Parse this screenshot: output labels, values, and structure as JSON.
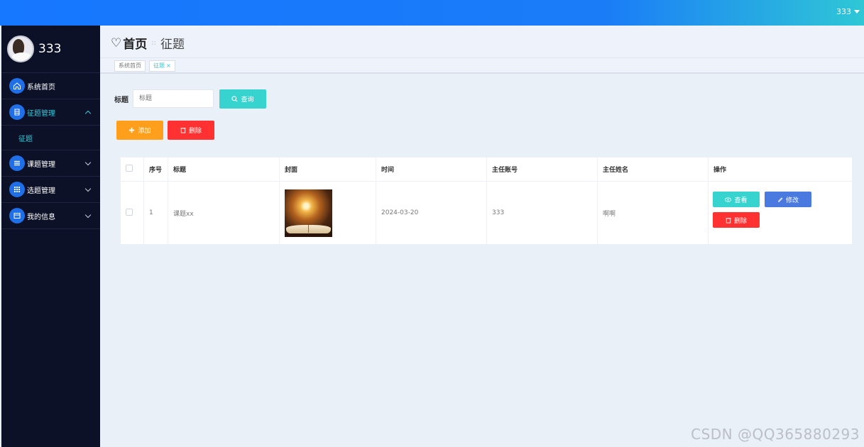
{
  "topbar": {
    "user": "333"
  },
  "sidebar": {
    "username": "333",
    "items": [
      {
        "label": "系统首页",
        "icon": "home-icon"
      },
      {
        "label": "征题管理",
        "icon": "book-icon"
      },
      {
        "label": "课题管理",
        "icon": "list-icon"
      },
      {
        "label": "选题管理",
        "icon": "grid-icon"
      },
      {
        "label": "我的信息",
        "icon": "card-icon"
      }
    ],
    "submenu": [
      {
        "label": "征题"
      }
    ]
  },
  "header": {
    "home": "首页",
    "separator": "::",
    "current": "征题"
  },
  "tags": [
    {
      "label": "系统首页"
    },
    {
      "label": "征题"
    }
  ],
  "search": {
    "label": "标题",
    "placeholder": "标题",
    "button": "查询"
  },
  "actions": {
    "add": "添加",
    "delete": "删除"
  },
  "table": {
    "headers": [
      "序号",
      "标题",
      "封面",
      "时间",
      "主任账号",
      "主任姓名",
      "操作"
    ],
    "rows": [
      {
        "index": "1",
        "title": "课题xx",
        "time": "2024-03-20",
        "account": "333",
        "name": "啊啊"
      }
    ],
    "ops": {
      "view": "查看",
      "edit": "修改",
      "delete": "删除"
    }
  },
  "watermark": "CSDN @QQ365880293",
  "colors": {
    "accent": "#1677ff",
    "teal": "#36d3cf",
    "orange": "#ff9f1c",
    "red": "#ff3131",
    "blue": "#4a7ae0",
    "sidebar": "#0c1128"
  }
}
